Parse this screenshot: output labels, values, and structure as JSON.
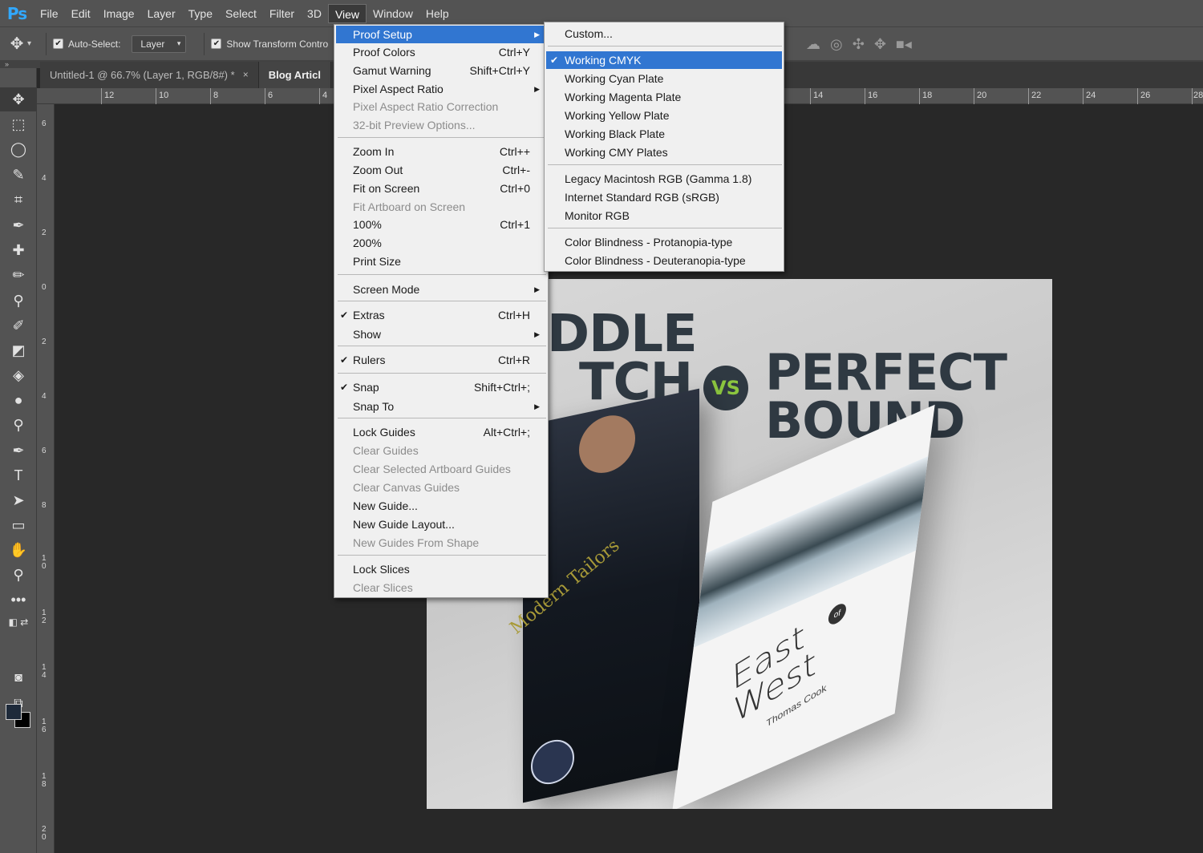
{
  "app": {
    "logo": "Ps"
  },
  "menubar": {
    "items": [
      "File",
      "Edit",
      "Image",
      "Layer",
      "Type",
      "Select",
      "Filter",
      "3D",
      "View",
      "Window",
      "Help"
    ],
    "active": "View"
  },
  "options": {
    "auto_select_label": "Auto-Select:",
    "auto_select_checked": true,
    "layer_select_value": "Layer",
    "show_transform_label": "Show Transform Contro",
    "show_transform_checked": true
  },
  "tabs": [
    {
      "label": "Untitled-1 @ 66.7% (Layer 1, RGB/8#) *",
      "close": "×"
    },
    {
      "label": "Blog Articl"
    }
  ],
  "ruler_top_labels": [
    "12",
    "10",
    "8",
    "6",
    "4",
    "14",
    "16",
    "18",
    "20",
    "22",
    "24",
    "26",
    "28"
  ],
  "ruler_left_labels": [
    "6",
    "4",
    "2",
    "0",
    "2",
    "4",
    "6",
    "8",
    "10",
    "12",
    "14",
    "16",
    "18",
    "20"
  ],
  "artwork": {
    "headline_left_1": "DDLE",
    "headline_left_2": "TCH",
    "vs": "VS",
    "headline_right_1": "PERFECT",
    "headline_right_2": "BOUND",
    "brochure_text": "Modern Tailors",
    "book_title_1": "East",
    "book_title_of": "of",
    "book_title_2": "West",
    "book_author": "Thomas Cook"
  },
  "view_menu": {
    "proof_setup": "Proof Setup",
    "proof_colors": "Proof Colors",
    "proof_colors_sc": "Ctrl+Y",
    "gamut_warning": "Gamut Warning",
    "gamut_warning_sc": "Shift+Ctrl+Y",
    "pixel_aspect_ratio": "Pixel Aspect Ratio",
    "pixel_aspect_ratio_correction": "Pixel Aspect Ratio Correction",
    "preview_32bit": "32-bit Preview Options...",
    "zoom_in": "Zoom In",
    "zoom_in_sc": "Ctrl++",
    "zoom_out": "Zoom Out",
    "zoom_out_sc": "Ctrl+-",
    "fit_on_screen": "Fit on Screen",
    "fit_on_screen_sc": "Ctrl+0",
    "fit_artboard": "Fit Artboard on Screen",
    "pct100": "100%",
    "pct100_sc": "Ctrl+1",
    "pct200": "200%",
    "print_size": "Print Size",
    "screen_mode": "Screen Mode",
    "extras": "Extras",
    "extras_sc": "Ctrl+H",
    "show": "Show",
    "rulers": "Rulers",
    "rulers_sc": "Ctrl+R",
    "snap": "Snap",
    "snap_sc": "Shift+Ctrl+;",
    "snap_to": "Snap To",
    "lock_guides": "Lock Guides",
    "lock_guides_sc": "Alt+Ctrl+;",
    "clear_guides": "Clear Guides",
    "clear_selected_artboard_guides": "Clear Selected Artboard Guides",
    "clear_canvas_guides": "Clear Canvas Guides",
    "new_guide": "New Guide...",
    "new_guide_layout": "New Guide Layout...",
    "new_guides_from_shape": "New Guides From Shape",
    "lock_slices": "Lock Slices",
    "clear_slices": "Clear Slices",
    "check": "✔",
    "arrow": "▶"
  },
  "proof_submenu": {
    "custom": "Custom...",
    "working_cmyk": "Working CMYK",
    "working_cyan": "Working Cyan Plate",
    "working_magenta": "Working Magenta Plate",
    "working_yellow": "Working Yellow Plate",
    "working_black": "Working Black Plate",
    "working_cmy": "Working CMY Plates",
    "legacy_mac": "Legacy Macintosh RGB (Gamma 1.8)",
    "internet_srgb": "Internet Standard RGB (sRGB)",
    "monitor_rgb": "Monitor RGB",
    "protanopia": "Color Blindness - Protanopia-type",
    "deuteranopia": "Color Blindness - Deuteranopia-type",
    "check": "✔"
  },
  "colors": {
    "accent": "#3176d1",
    "vs_green": "#8cc63f",
    "headline": "#2f3942"
  }
}
